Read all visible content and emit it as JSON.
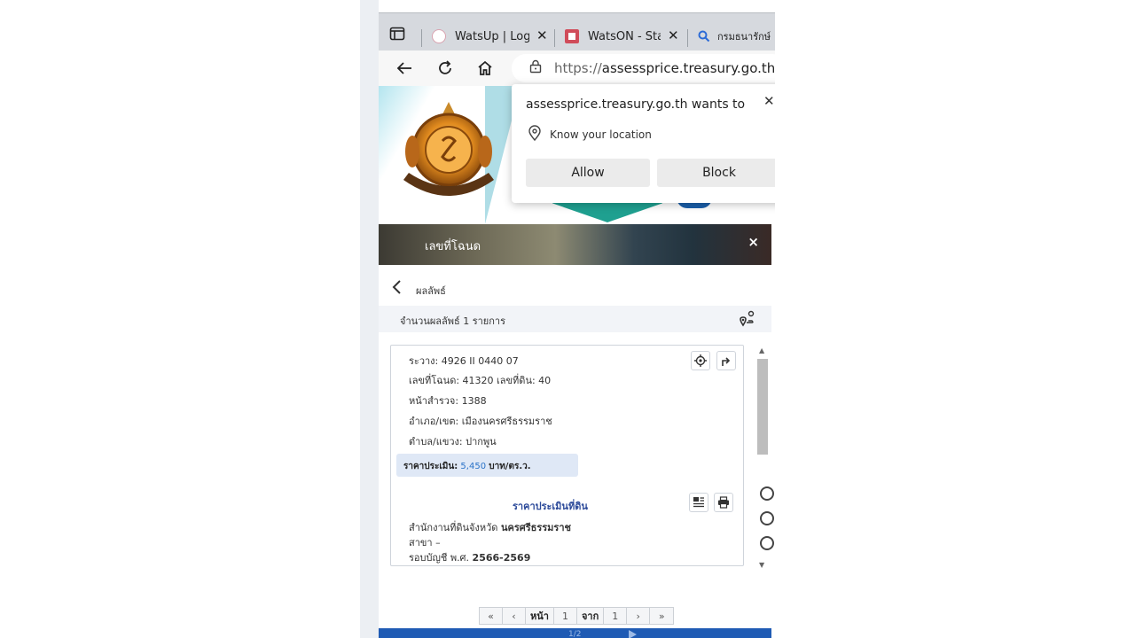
{
  "browser": {
    "tabs": [
      {
        "title": "WatsUp | Login",
        "favicon_color": "#e3a7b4"
      },
      {
        "title": "WatsON - Stay",
        "favicon_color": "#d04c5a"
      },
      {
        "title": "กรมธนารักษ์",
        "favicon_color": "#2c6bd6"
      }
    ],
    "address": {
      "scheme": "https://",
      "host": "assessprice.treasury.go.th"
    }
  },
  "permission_popup": {
    "title": "assessprice.treasury.go.th wants to",
    "permission": "Know your location",
    "allow_label": "Allow",
    "block_label": "Block"
  },
  "page": {
    "banner_title": "เลขที่โฉนด",
    "banner_close": "×",
    "results_title": "ผลลัพธ์",
    "results_count": "จำนวนผลลัพธ์ 1 รายการ",
    "record": {
      "lines": [
        "ระวาง: 4926 II 0440 07",
        "เลขที่โฉนด: 41320 เลขที่ดิน: 40",
        "หน้าสำรวจ: 1388",
        "อำเภอ/เขต: เมืองนครศรีธรรมราช",
        "ตำบล/แขวง: ปากพูน"
      ],
      "price_label": "ราคาประเมิน:",
      "price_value": "5,450",
      "price_unit": "บาท/ตร.ว.",
      "section_title": "ราคาประเมินที่ดิน",
      "office_label": "สำนักงานที่ดินจังหวัด",
      "office_value": "นครศรีธรรมราช",
      "branch": "สาขา –",
      "fiscal_label": "รอบบัญชี พ.ศ.",
      "fiscal_value": "2566-2569"
    },
    "pager": {
      "first": "«",
      "prev": "‹",
      "page_label": "หน้า",
      "page": "1",
      "of_label": "จาก",
      "total": "1",
      "next": "›",
      "last": "»"
    },
    "footer_label": "1/2"
  },
  "colors": {
    "accent_blue": "#2b73c8",
    "section_title": "#2c4a9a",
    "footer": "#1f5bb4",
    "header_green": "#1fa090"
  }
}
